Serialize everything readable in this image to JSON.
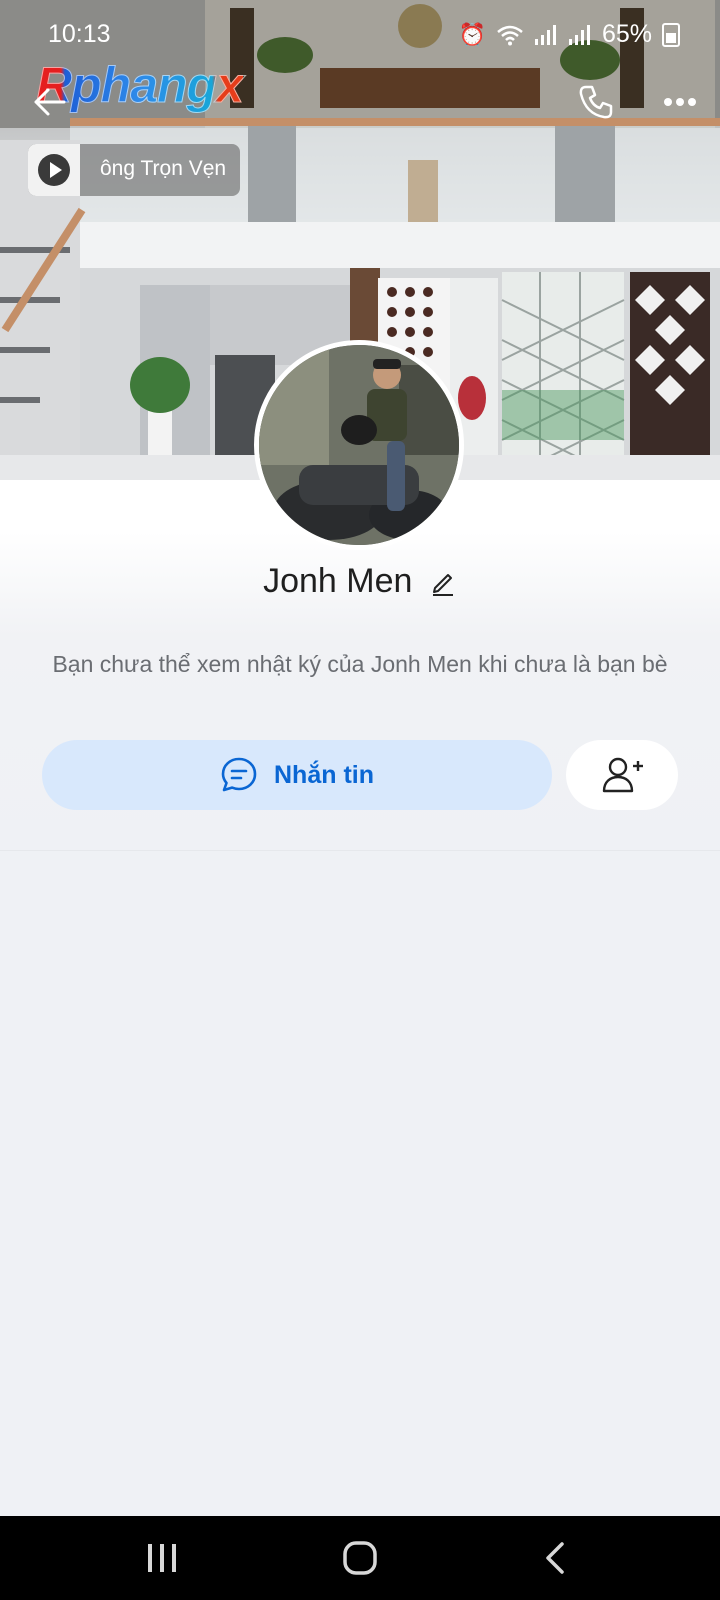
{
  "status_bar": {
    "time": "10:13",
    "battery": "65%"
  },
  "cover": {
    "brand": "Rphangx",
    "music_title": "ông Trọn Vẹn"
  },
  "profile": {
    "name": "Jonh Men",
    "privacy_note": "Bạn chưa thể xem nhật ký của Jonh Men khi chưa là bạn bè",
    "message_button": "Nhắn tin"
  },
  "colors": {
    "accent": "#0a66d3",
    "message_button_bg": "#d8e8fc",
    "page_bg": "#eff1f5"
  },
  "icons": [
    "back-icon",
    "phone-icon",
    "more-icon",
    "play-icon",
    "edit-icon",
    "chat-icon",
    "add-friend-icon",
    "recents-icon",
    "home-icon",
    "nav-back-icon"
  ]
}
